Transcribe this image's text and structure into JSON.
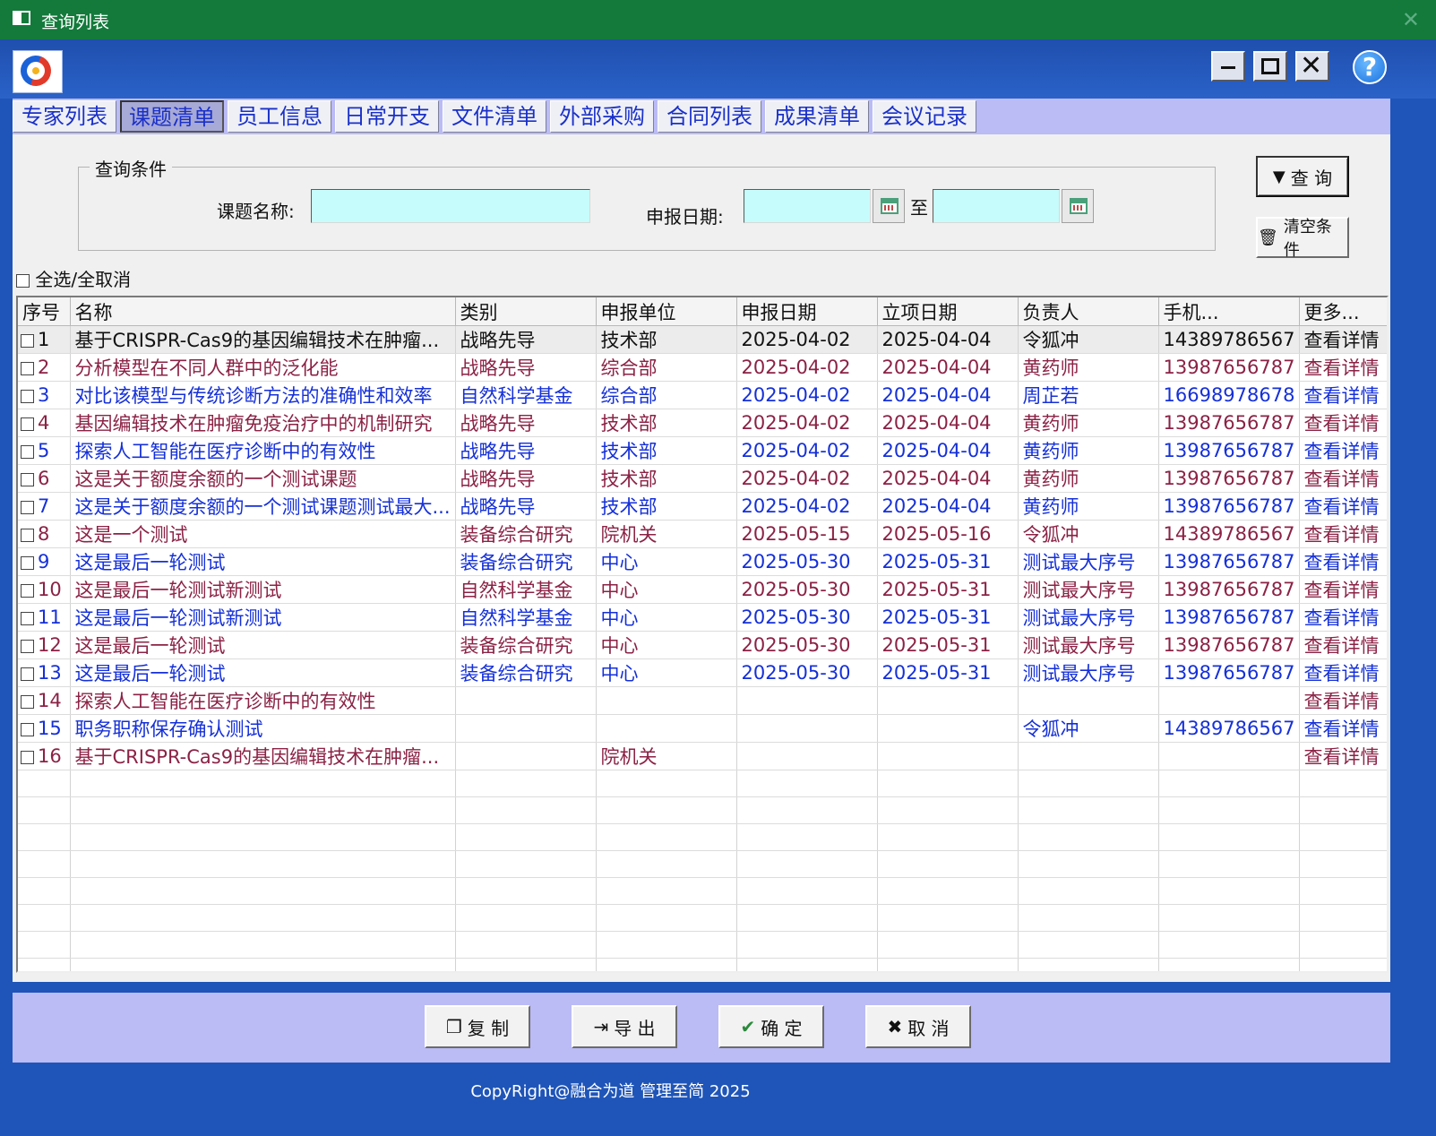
{
  "window": {
    "title": "查询列表"
  },
  "tabs": [
    "专家列表",
    "课题清单",
    "员工信息",
    "日常开支",
    "文件清单",
    "外部采购",
    "合同列表",
    "成果清单",
    "会议记录"
  ],
  "query": {
    "group_label": "查询条件",
    "name_label": "课题名称:",
    "name_value": "",
    "date_label": "申报日期:",
    "date_from": "",
    "date_to_sep": "至",
    "date_to": "",
    "search_label": "查 询",
    "clear_label": "清空条件"
  },
  "select_all_label": "全选/全取消",
  "table": {
    "headers": [
      "序号",
      "名称",
      "类别",
      "申报单位",
      "申报日期",
      "立项日期",
      "负责人",
      "手机...",
      "更多..."
    ],
    "rows": [
      [
        "1",
        "基于CRISPR-Cas9的基因编辑技术在肿瘤...",
        "战略先导",
        "技术部",
        "2025-04-02",
        "2025-04-04",
        "令狐冲",
        "14389786567",
        "查看详情"
      ],
      [
        "2",
        "分析模型在不同人群中的泛化能",
        "战略先导",
        "综合部",
        "2025-04-02",
        "2025-04-04",
        "黄药师",
        "13987656787",
        "查看详情"
      ],
      [
        "3",
        "对比该模型与传统诊断方法的准确性和效率",
        "自然科学基金",
        "综合部",
        "2025-04-02",
        "2025-04-04",
        "周芷若",
        "16698978678",
        "查看详情"
      ],
      [
        "4",
        "基因编辑技术在肿瘤免疫治疗中的机制研究",
        "战略先导",
        "技术部",
        "2025-04-02",
        "2025-04-04",
        "黄药师",
        "13987656787",
        "查看详情"
      ],
      [
        "5",
        "探索人工智能在医疗诊断中的有效性",
        "战略先导",
        "技术部",
        "2025-04-02",
        "2025-04-04",
        "黄药师",
        "13987656787",
        "查看详情"
      ],
      [
        "6",
        "这是关于额度余额的一个测试课题",
        "战略先导",
        "技术部",
        "2025-04-02",
        "2025-04-04",
        "黄药师",
        "13987656787",
        "查看详情"
      ],
      [
        "7",
        "这是关于额度余额的一个测试课题测试最大...",
        "战略先导",
        "技术部",
        "2025-04-02",
        "2025-04-04",
        "黄药师",
        "13987656787",
        "查看详情"
      ],
      [
        "8",
        "这是一个测试",
        "装备综合研究",
        "院机关",
        "2025-05-15",
        "2025-05-16",
        "令狐冲",
        "14389786567",
        "查看详情"
      ],
      [
        "9",
        "这是最后一轮测试",
        "装备综合研究",
        "中心",
        "2025-05-30",
        "2025-05-31",
        "测试最大序号",
        "13987656787",
        "查看详情"
      ],
      [
        "10",
        "这是最后一轮测试新测试",
        "自然科学基金",
        "中心",
        "2025-05-30",
        "2025-05-31",
        "测试最大序号",
        "13987656787",
        "查看详情"
      ],
      [
        "11",
        "这是最后一轮测试新测试",
        "自然科学基金",
        "中心",
        "2025-05-30",
        "2025-05-31",
        "测试最大序号",
        "13987656787",
        "查看详情"
      ],
      [
        "12",
        "这是最后一轮测试",
        "装备综合研究",
        "中心",
        "2025-05-30",
        "2025-05-31",
        "测试最大序号",
        "13987656787",
        "查看详情"
      ],
      [
        "13",
        "这是最后一轮测试",
        "装备综合研究",
        "中心",
        "2025-05-30",
        "2025-05-31",
        "测试最大序号",
        "13987656787",
        "查看详情"
      ],
      [
        "14",
        "探索人工智能在医疗诊断中的有效性",
        "",
        "",
        "",
        "",
        "",
        "",
        "查看详情"
      ],
      [
        "15",
        "职务职称保存确认测试",
        "",
        "",
        "",
        "",
        "令狐冲",
        "14389786567",
        "查看详情"
      ],
      [
        "16",
        "基于CRISPR-Cas9的基因编辑技术在肿瘤...",
        "",
        "院机关",
        "",
        "",
        "",
        "",
        "查看详情"
      ]
    ]
  },
  "buttons": {
    "copy": "复 制",
    "export": "导 出",
    "ok": "确 定",
    "cancel": "取 消"
  },
  "footer": "CopyRight@融合为道 管理至简 2025",
  "colors": {
    "titlebar": "#137a3b",
    "accent": "#1f55b8",
    "tabbar": "#bbbbf6",
    "row_odd": "#8b2245",
    "row_even": "#1530d8",
    "input": "#c7fcfc"
  }
}
